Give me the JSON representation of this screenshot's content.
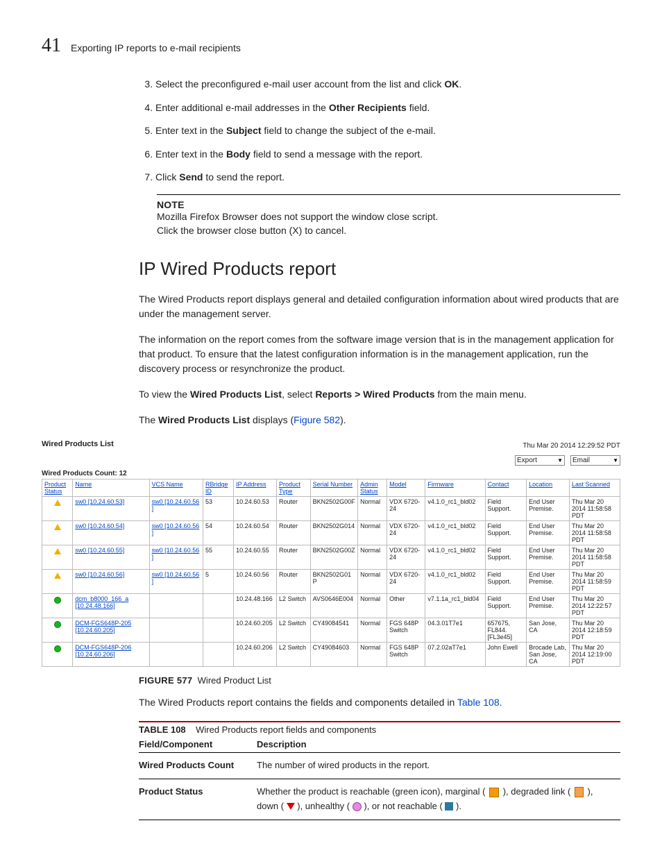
{
  "header": {
    "page_number": "41",
    "title": "Exporting IP reports to e-mail recipients"
  },
  "steps": [
    {
      "n": "3.",
      "pre": "Select the preconfigured e-mail user account from the list and click ",
      "bold": "OK",
      "post": "."
    },
    {
      "n": "4.",
      "pre": "Enter additional e-mail addresses in the ",
      "bold": "Other Recipients",
      "post": " field."
    },
    {
      "n": "5.",
      "pre": "Enter text in the ",
      "bold": "Subject",
      "post": " field to change the subject of the e-mail."
    },
    {
      "n": "6.",
      "pre": "Enter text in the ",
      "bold": "Body",
      "post": " field to send a message with the report."
    },
    {
      "n": "7.",
      "pre": "Click ",
      "bold": "Send",
      "post": " to send the report."
    }
  ],
  "note": {
    "label": "NOTE",
    "line1": "Mozilla Firefox Browser does not support the window close script.",
    "line2": "Click the browser close button (X) to cancel."
  },
  "section_heading": "IP Wired Products report",
  "para1": "The Wired Products report displays general and detailed configuration information about wired products that are under the management server.",
  "para2": "The information on the report comes from the software image version that is in the management application for that product. To ensure that the latest configuration information is in the management application, run the discovery process or resynchronize the product.",
  "para3": {
    "pre": "To view the ",
    "b1": "Wired Products List",
    "mid": ", select ",
    "b2": "Reports > Wired Products",
    "post": " from the main menu."
  },
  "para4": {
    "pre": "The ",
    "b": "Wired Products List",
    "mid": " displays (",
    "link": "Figure 582",
    "post": ")."
  },
  "embed": {
    "title": "Wired Products List",
    "timestamp": "Thu Mar 20 2014 12:29:52 PDT",
    "dd1": "Export",
    "dd2": "Email",
    "count_label": "Wired Products Count: 12",
    "headers": [
      "Product Status",
      "Name",
      "VCS Name",
      "RBridge ID",
      "IP Address",
      "Product Type",
      "Serial Number",
      "Admin Status",
      "Model",
      "Firmware",
      "Contact",
      "Location",
      "Last Scanned"
    ],
    "rows": [
      {
        "icon": "warn",
        "name": "sw0 [10.24.60.53]",
        "vcs": "sw0 [10.24.60.56 ]",
        "rb": "53",
        "ip": "10.24.60.53",
        "ptype": "Router",
        "serial": "BKN2502G00F",
        "admin": "Normal",
        "model": "VDX 6720-24",
        "fw": "v4.1.0_rc1_bld02",
        "contact": "Field Support.",
        "loc": "End User Premise.",
        "last": "Thu Mar 20 2014 11:58:58 PDT"
      },
      {
        "icon": "warn",
        "name": "sw0 [10.24.60.54]",
        "vcs": "sw0 [10.24.60.56 ]",
        "rb": "54",
        "ip": "10.24.60.54",
        "ptype": "Router",
        "serial": "BKN2502G014",
        "admin": "Normal",
        "model": "VDX 6720-24",
        "fw": "v4.1.0_rc1_bld02",
        "contact": "Field Support.",
        "loc": "End User Premise.",
        "last": "Thu Mar 20 2014 11:58:58 PDT"
      },
      {
        "icon": "warn",
        "name": "sw0 [10.24.60.55]",
        "vcs": "sw0 [10.24.60.56 ]",
        "rb": "55",
        "ip": "10.24.60.55",
        "ptype": "Router",
        "serial": "BKN2502G00Z",
        "admin": "Normal",
        "model": "VDX 6720-24",
        "fw": "v4.1.0_rc1_bld02",
        "contact": "Field Support.",
        "loc": "End User Premise.",
        "last": "Thu Mar 20 2014 11:58:58 PDT"
      },
      {
        "icon": "warn",
        "name": "sw0 [10.24.60.56]",
        "vcs": "sw0 [10.24.60.56 ]",
        "rb": "5",
        "ip": "10.24.60.56",
        "ptype": "Router",
        "serial": "BKN2502G01P",
        "admin": "Normal",
        "model": "VDX 6720-24",
        "fw": "v4.1.0_rc1_bld02",
        "contact": "Field Support.",
        "loc": "End User Premise.",
        "last": "Thu Mar 20 2014 11:58:59 PDT"
      },
      {
        "icon": "green",
        "name": "dcm_b8000_166_a [10.24.48.166]",
        "vcs": "",
        "rb": "",
        "ip": "10.24.48.166",
        "ptype": "L2 Switch",
        "serial": "AVS0646E004",
        "admin": "Normal",
        "model": "Other",
        "fw": "v7.1.1a_rc1_bld04",
        "contact": "Field Support.",
        "loc": "End User Premise.",
        "last": "Thu Mar 20 2014 12:22:57 PDT"
      },
      {
        "icon": "green",
        "name": "DCM-FGS648P-205 [10.24.60.205]",
        "vcs": "",
        "rb": "",
        "ip": "10.24.60.205",
        "ptype": "L2 Switch",
        "serial": "CY49084541",
        "admin": "Normal",
        "model": "FGS 648P Switch",
        "fw": "04.3.01T7e1",
        "contact": "657675, FL844. [FL3e45]",
        "loc": "San Jose, CA",
        "last": "Thu Mar 20 2014 12:18:59 PDT"
      },
      {
        "icon": "green",
        "name": "DCM-FGS648P-206 [10.24.60.206]",
        "vcs": "",
        "rb": "",
        "ip": "10.24.60.206",
        "ptype": "L2 Switch",
        "serial": "CY49084603",
        "admin": "Normal",
        "model": "FGS 648P Switch",
        "fw": "07.2.02aT7e1",
        "contact": "John Ewell",
        "loc": "Brocade Lab, San Jose, CA",
        "last": "Thu Mar 20 2014 12:19:00 PDT"
      }
    ]
  },
  "fig_caption": {
    "label": "FIGURE 577",
    "text": "Wired Product List"
  },
  "para5": {
    "pre": "The Wired Products report contains the fields and components detailed in ",
    "link": "Table 108",
    "post": "."
  },
  "table_caption": {
    "label": "TABLE 108",
    "text": "Wired Products report fields and components"
  },
  "t108": {
    "h1": "Field/Component",
    "h2": "Description",
    "r1c1": "Wired Products Count",
    "r1c2": "The number of wired products in the report.",
    "r2c1": "Product Status",
    "r2c2_pre": "Whether the product is reachable (green icon), marginal ( ",
    "r2c2_mid1": " ), degraded link ( ",
    "r2c2_mid2": " ), down ( ",
    "r2c2_mid3": " ), unhealthy ( ",
    "r2c2_mid4": " ), or not reachable ( ",
    "r2c2_post": " )."
  }
}
